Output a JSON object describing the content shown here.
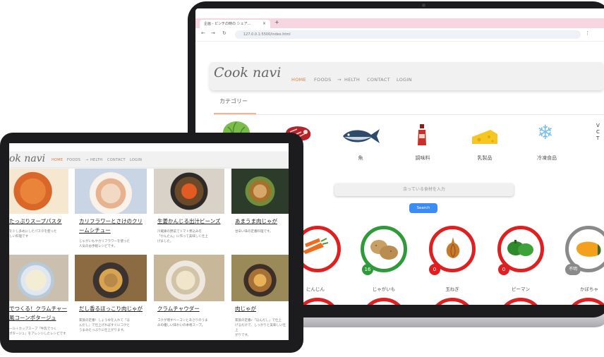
{
  "laptop": {
    "tab_title": "企画 - ピンチの時の シェア…",
    "tab_close": "×",
    "tab_new": "+",
    "url": "127.0.0.1:5500/index.html",
    "logo": "Cook navi",
    "menu": [
      "HOME",
      "FOODS",
      "HELTH",
      "CONTACT",
      "LOGIN"
    ],
    "category_heading": "カテゴリー",
    "categories": [
      {
        "label": "",
        "icon": "cabbage-icon"
      },
      {
        "label": "",
        "icon": "steak-icon"
      },
      {
        "label": "魚",
        "icon": "fish-icon"
      },
      {
        "label": "調味料",
        "icon": "ketchup-bottle-icon"
      },
      {
        "label": "乳製品",
        "icon": "cheese-icon"
      },
      {
        "label": "冷凍食品",
        "icon": "snowflake-icon"
      }
    ],
    "search_placeholder": "余っている食材を入力",
    "search_button": "Search",
    "ingredients": [
      {
        "label": "にんじん",
        "count": "",
        "ring_color": "#e02020",
        "icon": "carrot-icon"
      },
      {
        "label": "じゃがいも",
        "count": "16",
        "ring_color": "#2e9a3a",
        "icon": "potato-icon"
      },
      {
        "label": "玉ねぎ",
        "count": "0",
        "ring_color": "#e02020",
        "icon": "onion-icon"
      },
      {
        "label": "ピーマン",
        "count": "0",
        "ring_color": "#e02020",
        "icon": "green-pepper-icon"
      },
      {
        "label": "かぼちゃ",
        "count": "不明",
        "ring_color": "#8a8a8a",
        "icon": "pumpkin-icon"
      }
    ]
  },
  "tablet": {
    "logo": "ok navi",
    "menu": [
      "HOME",
      "FOODS",
      "HELTH",
      "CONTACT",
      "LOGIN"
    ],
    "recipes": [
      {
        "title": "たっぷりスープパスタ",
        "desc": "を少し多めにしたパスタを使った\nしい料理です"
      },
      {
        "title": "カリフラワーとさけのクリームシチュー",
        "desc": "じゃがいもやカリフラワーを使った\n人気のお手軽レシピです。"
      },
      {
        "title": "生姜かんじる出汁ビーンズ",
        "desc": "冷蔵庫の野菜でトマト煮込みを\n「かんたん」に作って美味しく仕上\nげました。"
      },
      {
        "title": "あまうま肉じゃが",
        "desc": "甘辛い味の定番料理です。"
      },
      {
        "title": "でつくる！クラムチャー風コーンポタージュ",
        "desc": "ール＋カップスープ「牛乳でつく\nポタージュ」をアレンジしたレシピです"
      },
      {
        "title": "だし香るほっこり肉じゃが",
        "desc": "家族の定番！しょうゆを入れて「ほ\nんだし」で仕上げればすぐにコクと\nうまみたっぷりに仕上がります。"
      },
      {
        "title": "クラムチャウダー",
        "desc": "コクが増すベーコンとあさりのうま\nみの優しい味わいの本格スープ。"
      },
      {
        "title": "肉じゃが",
        "desc": "家族の定番♪「ほんだし」で仕上\nげるだけで、しっかりと美味しい仕上\nがりです。"
      }
    ]
  }
}
